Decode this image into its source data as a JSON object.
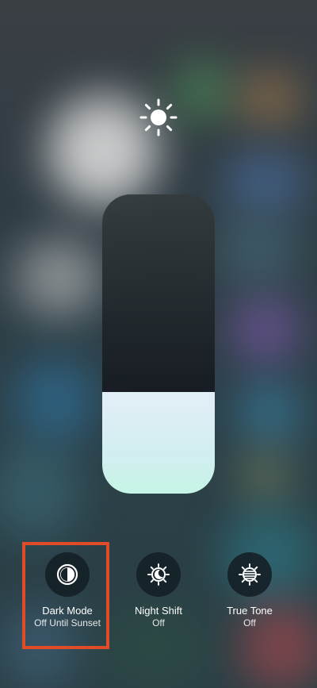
{
  "brightness": {
    "icon": "sun-icon",
    "level": 0.34
  },
  "controls": [
    {
      "icon": "dark-mode-icon",
      "label": "Dark Mode",
      "status": "Off Until Sunset"
    },
    {
      "icon": "night-shift-icon",
      "label": "Night Shift",
      "status": "Off"
    },
    {
      "icon": "true-tone-icon",
      "label": "True Tone",
      "status": "Off"
    }
  ],
  "colors": {
    "highlight": "#e04b28",
    "slider_fill": "#d6f0f0"
  }
}
